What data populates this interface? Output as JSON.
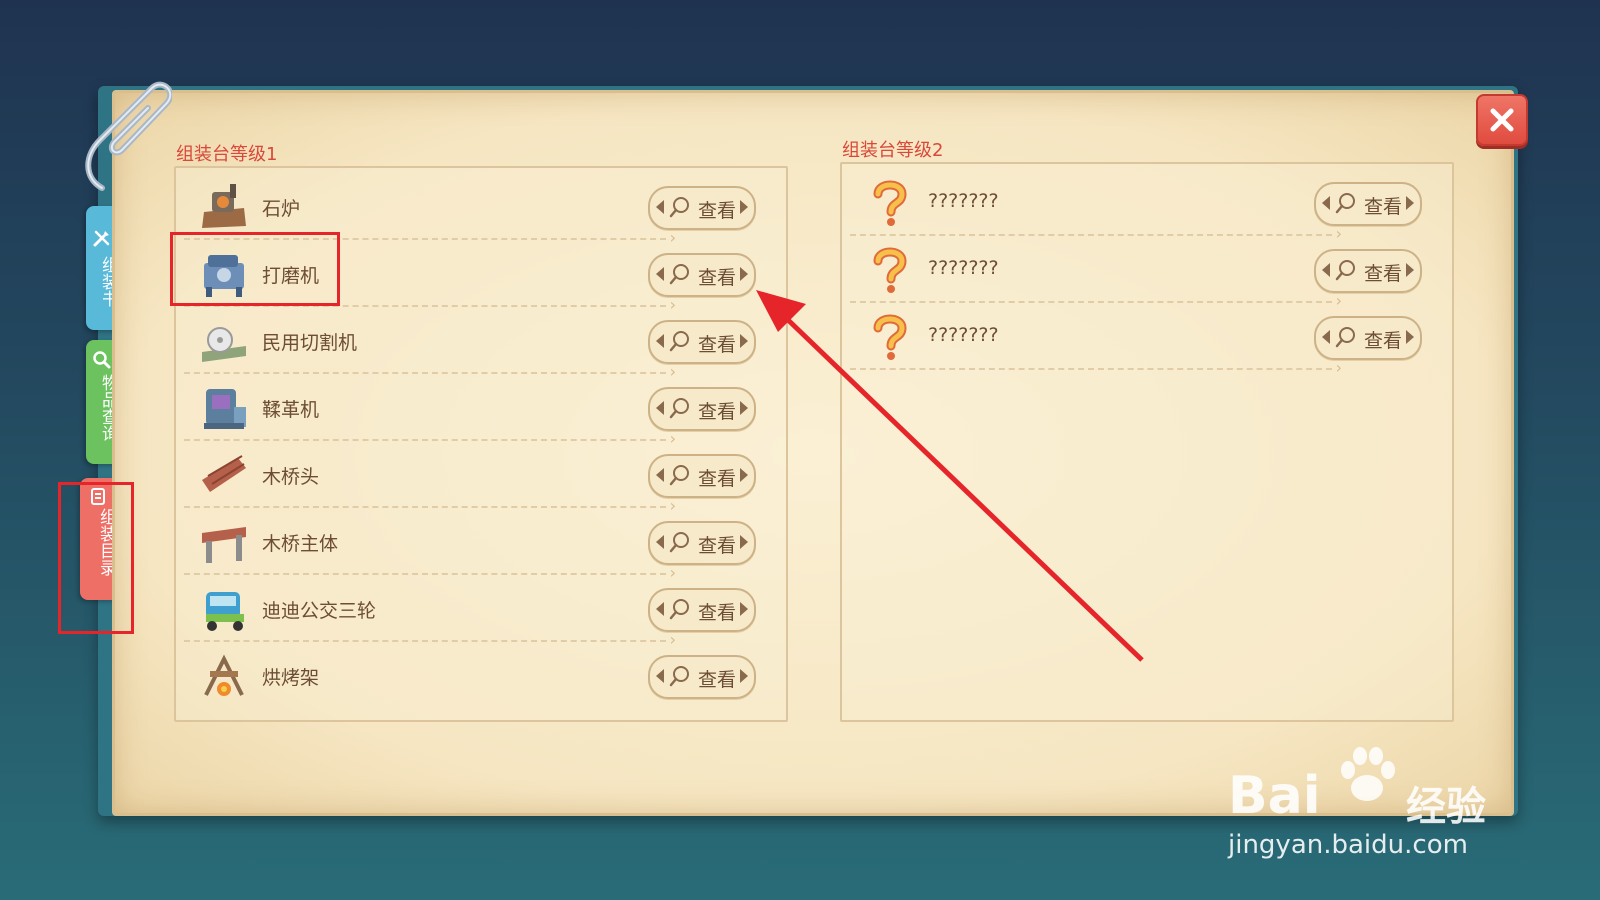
{
  "side_tabs": [
    {
      "label": "组装书",
      "icon": "tools-icon",
      "color": "#58b9d8"
    },
    {
      "label": "物品查询",
      "icon": "search-icon",
      "color": "#6cc25e"
    },
    {
      "label": "组装目录",
      "icon": "catalog-icon",
      "color": "#ee6f66"
    }
  ],
  "left_panel": {
    "title": "组装台等级1",
    "items": [
      {
        "name": "石炉",
        "button": "查看"
      },
      {
        "name": "打磨机",
        "button": "查看"
      },
      {
        "name": "民用切割机",
        "button": "查看"
      },
      {
        "name": "鞣革机",
        "button": "查看"
      },
      {
        "name": "木桥头",
        "button": "查看"
      },
      {
        "name": "木桥主体",
        "button": "查看"
      },
      {
        "name": "迪迪公交三轮",
        "button": "查看"
      },
      {
        "name": "烘烤架",
        "button": "查看"
      }
    ]
  },
  "right_panel": {
    "title": "组装台等级2",
    "items": [
      {
        "name": "???????",
        "button": "查看"
      },
      {
        "name": "???????",
        "button": "查看"
      },
      {
        "name": "???????",
        "button": "查看"
      }
    ]
  },
  "close_icon": "close-icon",
  "watermark": {
    "brand": "Bai",
    "brand_suffix": "经验",
    "url": "jingyan.baidu.com"
  },
  "colors": {
    "accent_red": "#e5252a",
    "title_red": "#d9483a",
    "text_brown": "#6d4d34"
  }
}
